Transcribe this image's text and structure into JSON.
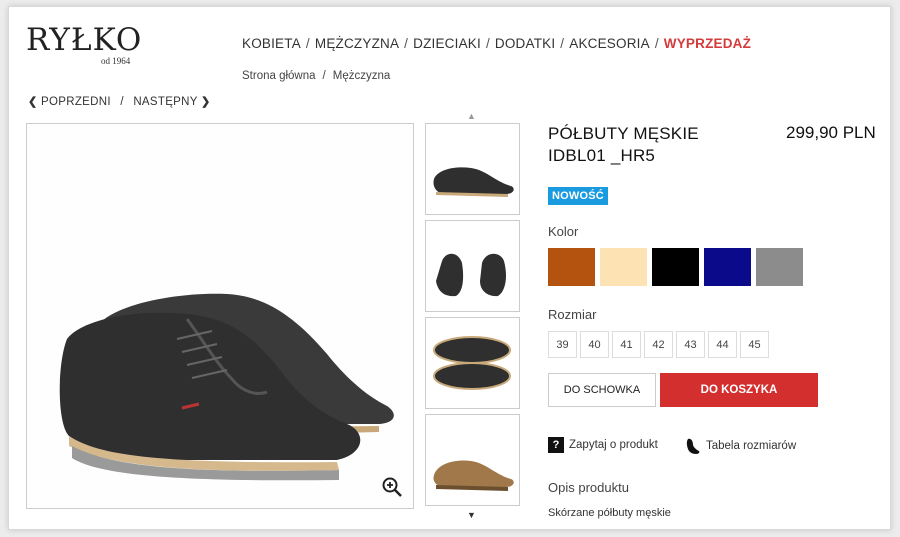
{
  "logo": {
    "brand": "RYŁKO",
    "since": "od 1964"
  },
  "nav": {
    "items": [
      "KOBIETA",
      "MĘŻCZYZNA",
      "DZIECIAKI",
      "DODATKI",
      "AKCESORIA"
    ],
    "separator": "/",
    "sale": "WYPRZEDAŻ"
  },
  "breadcrumb": {
    "items": [
      "Strona główna",
      "Mężczyzna"
    ],
    "separator": "/"
  },
  "pager": {
    "prev_chevron": "❮",
    "prev": "POPRZEDNI",
    "separator": "/",
    "next": "NASTĘPNY",
    "next_chevron": "❯"
  },
  "product": {
    "title_line1": "PÓŁBUTY MĘSKIE",
    "title_line2": "IDBL01 _HR5",
    "price": "299,90 PLN",
    "badge": "NOWOŚĆ",
    "color_label": "Kolor",
    "colors": [
      "#b3530f",
      "#fde3b4",
      "#000000",
      "#0a0a8a",
      "#8c8c8c"
    ],
    "size_label": "Rozmiar",
    "sizes": [
      "39",
      "40",
      "41",
      "42",
      "43",
      "44",
      "45"
    ],
    "fav_button": "DO SCHOWKA",
    "cart_button": "DO KOSZYKA",
    "ask_icon": "question-icon",
    "ask_label": "Zapytaj o produkt",
    "size_table_icon": "foot-icon",
    "size_table_label": "Tabela rozmiarów",
    "desc_heading": "Opis produktu",
    "desc_text": "Skórzane półbuty męskie"
  },
  "gallery": {
    "up_arrow": "▲",
    "down_arrow": "▼",
    "zoom_icon": "zoom-in-icon"
  }
}
